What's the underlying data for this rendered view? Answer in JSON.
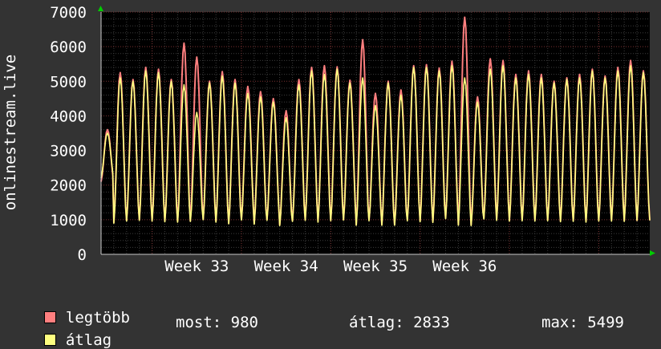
{
  "chart_data": {
    "type": "line",
    "ylabel": "onlinestream.live",
    "ylim": [
      0,
      7000
    ],
    "yticks": [
      0,
      1000,
      2000,
      3000,
      4000,
      5000,
      6000,
      7000
    ],
    "xlabels": [
      "Week 33",
      "Week 34",
      "Week 35",
      "Week 36"
    ],
    "days": 43,
    "series": [
      {
        "name": "legtöbb",
        "color": "#ff7f7f",
        "daily_peak": [
          3600,
          5250,
          5050,
          5400,
          5350,
          5050,
          6100,
          5700,
          5000,
          5280,
          5050,
          4850,
          4700,
          4500,
          4150,
          5050,
          5400,
          5450,
          5420,
          5030,
          6200,
          4650,
          5000,
          4750,
          5450,
          5480,
          5380,
          5580,
          6850,
          4550,
          5650,
          5600,
          5200,
          5300,
          5200,
          5000,
          5100,
          5200,
          5350,
          5150,
          5400,
          5600,
          5300
        ],
        "daily_min": [
          2100,
          920,
          980,
          1000,
          980,
          960,
          950,
          960,
          1020,
          950,
          900,
          1010,
          890,
          1000,
          850,
          970,
          1000,
          950,
          990,
          1010,
          860,
          990,
          860,
          860,
          990,
          960,
          940,
          1050,
          860,
          850,
          1040,
          1000,
          980,
          990,
          980,
          990,
          960,
          970,
          950,
          980,
          980,
          970,
          980
        ]
      },
      {
        "name": "átlag",
        "color": "#ffff80",
        "daily_peak": [
          3500,
          5100,
          5000,
          5300,
          5250,
          5000,
          4900,
          4100,
          4950,
          5150,
          4950,
          4650,
          4550,
          4400,
          3950,
          4900,
          5300,
          5200,
          5350,
          4950,
          5100,
          4300,
          4950,
          4600,
          5400,
          5400,
          5300,
          5450,
          5100,
          4400,
          5350,
          5450,
          5100,
          5200,
          5100,
          4950,
          5050,
          5100,
          5300,
          5100,
          5300,
          5450,
          5250
        ],
        "daily_min": [
          2200,
          900,
          960,
          980,
          960,
          940,
          930,
          950,
          1000,
          930,
          880,
          990,
          870,
          980,
          830,
          950,
          980,
          930,
          970,
          990,
          840,
          970,
          840,
          840,
          970,
          940,
          920,
          1030,
          840,
          830,
          1020,
          980,
          960,
          970,
          960,
          970,
          940,
          950,
          930,
          960,
          960,
          950,
          980
        ]
      }
    ],
    "stats": {
      "current_label": "most:",
      "current": "980",
      "average_label": "átlag:",
      "average": "2833",
      "max_label": "max:",
      "max": "5499"
    },
    "grid": true
  }
}
